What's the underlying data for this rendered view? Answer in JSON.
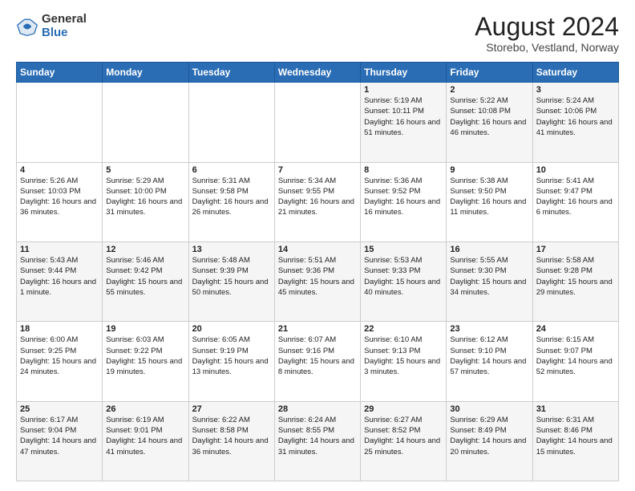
{
  "header": {
    "logo": {
      "general": "General",
      "blue": "Blue"
    },
    "title": "August 2024",
    "location": "Storebo, Vestland, Norway"
  },
  "weekdays": [
    "Sunday",
    "Monday",
    "Tuesday",
    "Wednesday",
    "Thursday",
    "Friday",
    "Saturday"
  ],
  "weeks": [
    [
      {
        "day": "",
        "sunrise": "",
        "sunset": "",
        "daylight": ""
      },
      {
        "day": "",
        "sunrise": "",
        "sunset": "",
        "daylight": ""
      },
      {
        "day": "",
        "sunrise": "",
        "sunset": "",
        "daylight": ""
      },
      {
        "day": "",
        "sunrise": "",
        "sunset": "",
        "daylight": ""
      },
      {
        "day": "1",
        "sunrise": "Sunrise: 5:19 AM",
        "sunset": "Sunset: 10:11 PM",
        "daylight": "Daylight: 16 hours and 51 minutes."
      },
      {
        "day": "2",
        "sunrise": "Sunrise: 5:22 AM",
        "sunset": "Sunset: 10:08 PM",
        "daylight": "Daylight: 16 hours and 46 minutes."
      },
      {
        "day": "3",
        "sunrise": "Sunrise: 5:24 AM",
        "sunset": "Sunset: 10:06 PM",
        "daylight": "Daylight: 16 hours and 41 minutes."
      }
    ],
    [
      {
        "day": "4",
        "sunrise": "Sunrise: 5:26 AM",
        "sunset": "Sunset: 10:03 PM",
        "daylight": "Daylight: 16 hours and 36 minutes."
      },
      {
        "day": "5",
        "sunrise": "Sunrise: 5:29 AM",
        "sunset": "Sunset: 10:00 PM",
        "daylight": "Daylight: 16 hours and 31 minutes."
      },
      {
        "day": "6",
        "sunrise": "Sunrise: 5:31 AM",
        "sunset": "Sunset: 9:58 PM",
        "daylight": "Daylight: 16 hours and 26 minutes."
      },
      {
        "day": "7",
        "sunrise": "Sunrise: 5:34 AM",
        "sunset": "Sunset: 9:55 PM",
        "daylight": "Daylight: 16 hours and 21 minutes."
      },
      {
        "day": "8",
        "sunrise": "Sunrise: 5:36 AM",
        "sunset": "Sunset: 9:52 PM",
        "daylight": "Daylight: 16 hours and 16 minutes."
      },
      {
        "day": "9",
        "sunrise": "Sunrise: 5:38 AM",
        "sunset": "Sunset: 9:50 PM",
        "daylight": "Daylight: 16 hours and 11 minutes."
      },
      {
        "day": "10",
        "sunrise": "Sunrise: 5:41 AM",
        "sunset": "Sunset: 9:47 PM",
        "daylight": "Daylight: 16 hours and 6 minutes."
      }
    ],
    [
      {
        "day": "11",
        "sunrise": "Sunrise: 5:43 AM",
        "sunset": "Sunset: 9:44 PM",
        "daylight": "Daylight: 16 hours and 1 minute."
      },
      {
        "day": "12",
        "sunrise": "Sunrise: 5:46 AM",
        "sunset": "Sunset: 9:42 PM",
        "daylight": "Daylight: 15 hours and 55 minutes."
      },
      {
        "day": "13",
        "sunrise": "Sunrise: 5:48 AM",
        "sunset": "Sunset: 9:39 PM",
        "daylight": "Daylight: 15 hours and 50 minutes."
      },
      {
        "day": "14",
        "sunrise": "Sunrise: 5:51 AM",
        "sunset": "Sunset: 9:36 PM",
        "daylight": "Daylight: 15 hours and 45 minutes."
      },
      {
        "day": "15",
        "sunrise": "Sunrise: 5:53 AM",
        "sunset": "Sunset: 9:33 PM",
        "daylight": "Daylight: 15 hours and 40 minutes."
      },
      {
        "day": "16",
        "sunrise": "Sunrise: 5:55 AM",
        "sunset": "Sunset: 9:30 PM",
        "daylight": "Daylight: 15 hours and 34 minutes."
      },
      {
        "day": "17",
        "sunrise": "Sunrise: 5:58 AM",
        "sunset": "Sunset: 9:28 PM",
        "daylight": "Daylight: 15 hours and 29 minutes."
      }
    ],
    [
      {
        "day": "18",
        "sunrise": "Sunrise: 6:00 AM",
        "sunset": "Sunset: 9:25 PM",
        "daylight": "Daylight: 15 hours and 24 minutes."
      },
      {
        "day": "19",
        "sunrise": "Sunrise: 6:03 AM",
        "sunset": "Sunset: 9:22 PM",
        "daylight": "Daylight: 15 hours and 19 minutes."
      },
      {
        "day": "20",
        "sunrise": "Sunrise: 6:05 AM",
        "sunset": "Sunset: 9:19 PM",
        "daylight": "Daylight: 15 hours and 13 minutes."
      },
      {
        "day": "21",
        "sunrise": "Sunrise: 6:07 AM",
        "sunset": "Sunset: 9:16 PM",
        "daylight": "Daylight: 15 hours and 8 minutes."
      },
      {
        "day": "22",
        "sunrise": "Sunrise: 6:10 AM",
        "sunset": "Sunset: 9:13 PM",
        "daylight": "Daylight: 15 hours and 3 minutes."
      },
      {
        "day": "23",
        "sunrise": "Sunrise: 6:12 AM",
        "sunset": "Sunset: 9:10 PM",
        "daylight": "Daylight: 14 hours and 57 minutes."
      },
      {
        "day": "24",
        "sunrise": "Sunrise: 6:15 AM",
        "sunset": "Sunset: 9:07 PM",
        "daylight": "Daylight: 14 hours and 52 minutes."
      }
    ],
    [
      {
        "day": "25",
        "sunrise": "Sunrise: 6:17 AM",
        "sunset": "Sunset: 9:04 PM",
        "daylight": "Daylight: 14 hours and 47 minutes."
      },
      {
        "day": "26",
        "sunrise": "Sunrise: 6:19 AM",
        "sunset": "Sunset: 9:01 PM",
        "daylight": "Daylight: 14 hours and 41 minutes."
      },
      {
        "day": "27",
        "sunrise": "Sunrise: 6:22 AM",
        "sunset": "Sunset: 8:58 PM",
        "daylight": "Daylight: 14 hours and 36 minutes."
      },
      {
        "day": "28",
        "sunrise": "Sunrise: 6:24 AM",
        "sunset": "Sunset: 8:55 PM",
        "daylight": "Daylight: 14 hours and 31 minutes."
      },
      {
        "day": "29",
        "sunrise": "Sunrise: 6:27 AM",
        "sunset": "Sunset: 8:52 PM",
        "daylight": "Daylight: 14 hours and 25 minutes."
      },
      {
        "day": "30",
        "sunrise": "Sunrise: 6:29 AM",
        "sunset": "Sunset: 8:49 PM",
        "daylight": "Daylight: 14 hours and 20 minutes."
      },
      {
        "day": "31",
        "sunrise": "Sunrise: 6:31 AM",
        "sunset": "Sunset: 8:46 PM",
        "daylight": "Daylight: 14 hours and 15 minutes."
      }
    ]
  ]
}
